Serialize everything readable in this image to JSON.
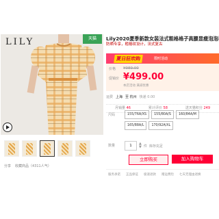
{
  "brand": "LILY",
  "badge": "天猫",
  "product": {
    "title": "Lily2020夏季新款女装法式粗格格子高腰显瘦泡泡袖连衣长款连衣",
    "subtitle": "防晒专享，粗格纹设计，法式复古"
  },
  "promo": {
    "tag": "夏日狂欢购",
    "text": "限时活动"
  },
  "price": {
    "orig_label": "价格",
    "orig_value": "¥989.00",
    "promo_label": "促销价",
    "value": "¥499.00",
    "note": "本店活动 满减优惠"
  },
  "shipping": {
    "label": "运费",
    "from": "上海",
    "to": "至 杭州",
    "fee": "快递 0.00"
  },
  "stats": {
    "sales_label": "月销量",
    "sales_value": "46",
    "reviews_label": "累计评价",
    "reviews_value": "58",
    "points_label": "送天猫积分",
    "points_value": "249"
  },
  "sizes_label": "尺码",
  "sizes": [
    "155/76A/XS",
    "155/80A/S",
    "160/84A/M",
    "165/88A/L",
    "170/92A/XL"
  ],
  "qty": {
    "label": "数量",
    "value": "1",
    "unit": "件",
    "note": "库存充足"
  },
  "buttons": {
    "buy": "立即购买",
    "cart": "加入购物车"
  },
  "services_label": "服务承诺",
  "services": [
    "正品保证",
    "极速退款",
    "赠运费险",
    "七天无理由退换"
  ],
  "share": {
    "label": "分享",
    "favorite": "收藏商品（4311人气）"
  },
  "colors": {
    "accent": "#ff0036",
    "promo_start": "#ff3c6e",
    "promo_end": "#ff6b2b",
    "tmall_green": "#3aa357"
  }
}
